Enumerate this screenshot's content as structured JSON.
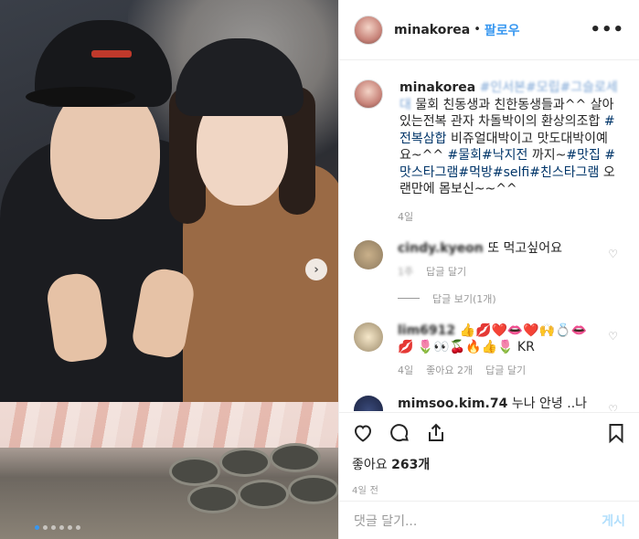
{
  "post": {
    "username": "minakorea",
    "separator": "•",
    "follow_label": "팔로우",
    "more_label": "•••",
    "next_label": "›",
    "photo_alt": "",
    "carousel": {
      "count": 6,
      "active": 0
    }
  },
  "caption": {
    "username": "minakorea",
    "blurred_tags": "#인서본#모립#그슬로세대",
    "text1": "물회 친동생과 친한동생들과^^ 살아있는전복 관자 차돌박이의 환상의조합",
    "tag1": "#전복삼합",
    "text2": " 비쥬얼대박이고 맛도대박이예요~^^",
    "tag2": "#물회",
    "tag3": "#낙지전",
    "text3": " 까지~",
    "tag4": "#맛집",
    "tag5": "#맛스타그램",
    "tag6": "#먹방",
    "tag7": "#selfi",
    "tag8": "#친스타그램",
    "text4": " 오랜만에 몸보신~~^^",
    "age": "4일"
  },
  "comments": [
    {
      "username": "cindy.kyeon",
      "text": "또 먹고싶어요",
      "age": "1주",
      "reply_label": "답글 달기",
      "view_replies": "답글 보기(1개)"
    },
    {
      "username": "lim6912",
      "text": "👍💋❤️👄❤️🙌💍👄💋 🌷👀🍒🔥👍🌷 KR",
      "age": "4일",
      "likes_label": "좋아요 2개",
      "reply_label": "답글 달기"
    },
    {
      "username": "mimsoo.kim.74",
      "text": "누나 안녕 ..나 민"
    }
  ],
  "actions": {
    "likes_prefix": "좋아요",
    "likes_count": "263개",
    "time": "4일 전"
  },
  "add_comment": {
    "placeholder": "댓글 달기...",
    "post_label": "게시"
  },
  "colors": {
    "link_blue": "#3897f0",
    "hashtag_blue": "#003569",
    "muted_gray": "#999999",
    "post_btn_disabled": "#b2dffc"
  }
}
